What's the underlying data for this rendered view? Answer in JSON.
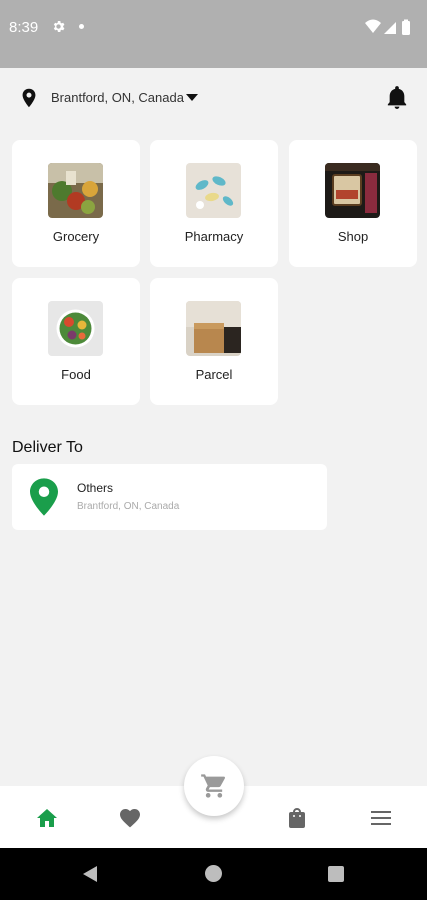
{
  "status_bar": {
    "time": "8:39"
  },
  "location": {
    "label": "Brantford, ON, Canada"
  },
  "categories": [
    {
      "label": "Grocery"
    },
    {
      "label": "Pharmacy"
    },
    {
      "label": "Shop"
    },
    {
      "label": "Food"
    },
    {
      "label": "Parcel"
    }
  ],
  "deliver": {
    "title": "Deliver To",
    "name": "Others",
    "address": "Brantford, ON, Canada"
  },
  "colors": {
    "accent": "#1a9e4b",
    "background": "#f2f2f2",
    "status_bar": "#b0b0b0"
  },
  "icons": {
    "location": "location-pin-icon",
    "notifications": "bell-icon",
    "cart": "cart-icon",
    "home": "home-icon",
    "favorites": "heart-icon",
    "orders": "shopping-bag-icon",
    "menu": "menu-icon"
  }
}
